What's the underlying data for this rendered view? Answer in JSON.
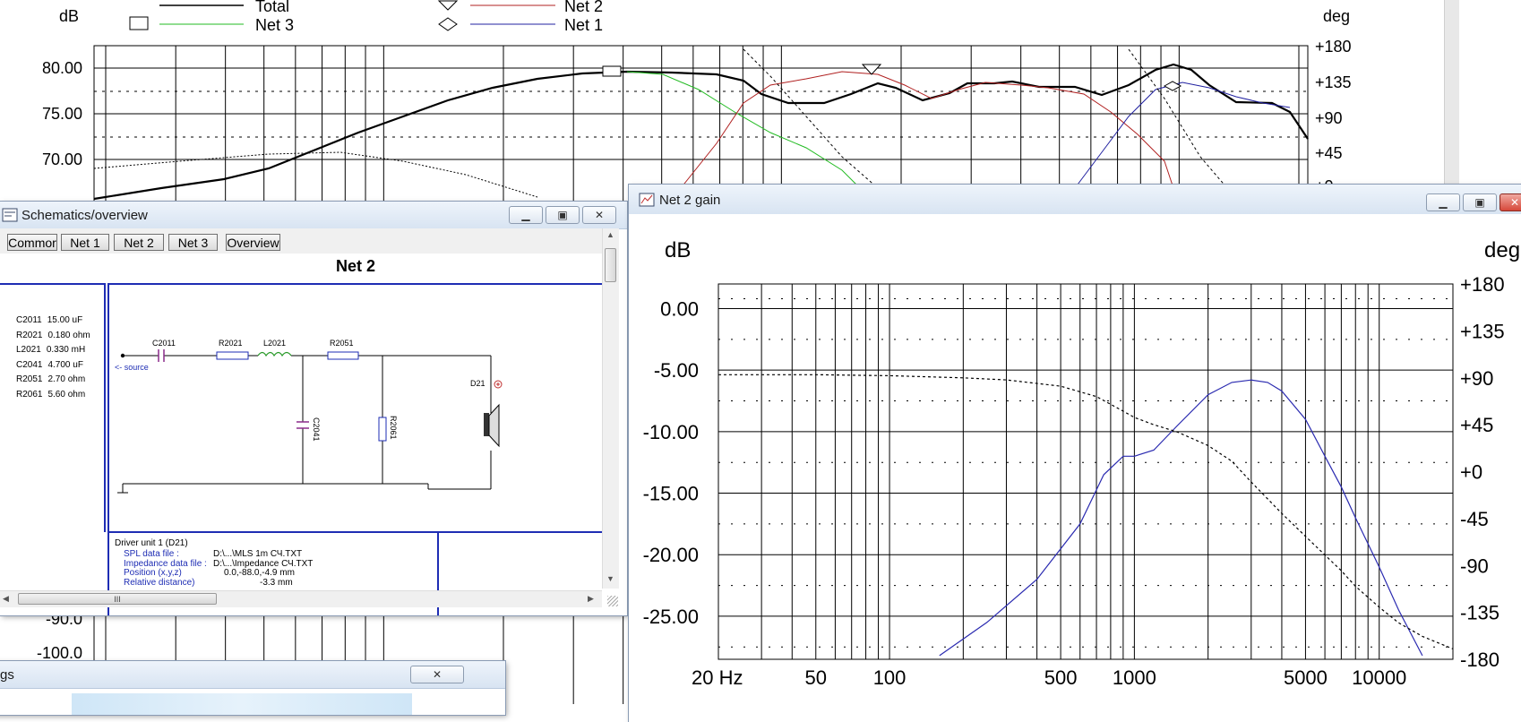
{
  "bg_chart": {
    "left_unit": "dB",
    "right_unit": "deg",
    "left_ticks": [
      "80.00",
      "75.00",
      "70.00"
    ],
    "lower_left_ticks": [
      "-90.0",
      "-100.0"
    ],
    "right_ticks": [
      "+180",
      "+135",
      "+90",
      "+45",
      "+0"
    ],
    "legend": [
      {
        "label": "Total",
        "color": "#000000",
        "marker": "square"
      },
      {
        "label": "Net 3",
        "color": "#22bb22",
        "marker": "square"
      },
      {
        "label": "Net 2",
        "color": "#b02020",
        "marker": "triangle"
      },
      {
        "label": "Net 1",
        "color": "#2020a0",
        "marker": "diamond"
      }
    ]
  },
  "schematics": {
    "title": "Schematics/overview",
    "tabs": [
      "Commor",
      "Net 1",
      "Net 2",
      "Net 3",
      "Overview"
    ],
    "heading": "Net 2",
    "components": [
      {
        "ref": "C2011",
        "value": "15.00 uF"
      },
      {
        "ref": "R2021",
        "value": "0.180 ohm"
      },
      {
        "ref": "L2021",
        "value": "0.330 mH"
      },
      {
        "ref": "C2041",
        "value": "4.700 uF"
      },
      {
        "ref": "R2051",
        "value": "2.70 ohm"
      },
      {
        "ref": "R2061",
        "value": "5.60 ohm"
      }
    ],
    "labels": {
      "source": "<- source",
      "driver": "D21",
      "c2011": "C2011",
      "r2021": "R2021",
      "l2021": "L2021",
      "r2051": "R2051",
      "c2041": "C2041",
      "r2061": "R2061"
    },
    "driver_info": {
      "heading": "Driver unit 1 (D21)",
      "rows": [
        {
          "label": "SPL data file :",
          "value": "D:\\...\\MLS 1m СЧ.TXT"
        },
        {
          "label": "Impedance data file :",
          "value": "D:\\...\\Impedance СЧ.TXT"
        },
        {
          "label": "Position (x,y,z)",
          "value": "0.0,-88.0,-4.9 mm"
        },
        {
          "label": "Relative distance)",
          "value": "-3.3 mm"
        }
      ]
    },
    "hscroll_glyph": "III"
  },
  "small_window": {
    "title_fragment": "gs"
  },
  "net2_gain": {
    "title": "Net 2 gain",
    "chart_data": {
      "type": "line",
      "title": "",
      "ylabel": "dB",
      "y2label": "deg",
      "x_scale": "log",
      "xlim": [
        20,
        20000
      ],
      "ylim": [
        -28.5,
        2
      ],
      "y2lim": [
        -180,
        180
      ],
      "x_tick_labels": [
        {
          "v": 20,
          "t": "20 Hz"
        },
        {
          "v": 50,
          "t": "50"
        },
        {
          "v": 100,
          "t": "100"
        },
        {
          "v": 500,
          "t": "500"
        },
        {
          "v": 1000,
          "t": "1000"
        },
        {
          "v": 5000,
          "t": "5000"
        },
        {
          "v": 10000,
          "t": "10000"
        }
      ],
      "y_tick_labels": [
        {
          "v": 0,
          "t": "0.00"
        },
        {
          "v": -5,
          "t": "-5.00"
        },
        {
          "v": -10,
          "t": "-10.00"
        },
        {
          "v": -15,
          "t": "-15.00"
        },
        {
          "v": -20,
          "t": "-20.00"
        },
        {
          "v": -25,
          "t": "-25.00"
        }
      ],
      "y2_tick_labels": [
        {
          "v": 180,
          "t": "+180"
        },
        {
          "v": 135,
          "t": "+135"
        },
        {
          "v": 90,
          "t": "+90"
        },
        {
          "v": 45,
          "t": "+45"
        },
        {
          "v": 0,
          "t": "+0"
        },
        {
          "v": -45,
          "t": "-45"
        },
        {
          "v": -90,
          "t": "-90"
        },
        {
          "v": -135,
          "t": "-135"
        },
        {
          "v": -180,
          "t": "-180"
        }
      ],
      "grid": true,
      "series": [
        {
          "axis": "left",
          "style": "solid",
          "color": "#2a2ab0",
          "x": [
            160,
            250,
            400,
            600,
            750,
            900,
            1000,
            1200,
            1500,
            2000,
            2500,
            3000,
            3500,
            4000,
            5000,
            6000,
            7000,
            8000,
            10000,
            12000,
            15000
          ],
          "y": [
            -28.2,
            -25.5,
            -22,
            -17.5,
            -13.5,
            -12,
            -12,
            -11.5,
            -9.5,
            -7,
            -6,
            -5.8,
            -6,
            -6.7,
            -9,
            -12,
            -14.5,
            -17,
            -21,
            -24.5,
            -28.2
          ]
        },
        {
          "axis": "right",
          "style": "dotted",
          "color": "#000000",
          "x": [
            20,
            50,
            100,
            200,
            300,
            500,
            700,
            900,
            1000,
            1200,
            1500,
            2000,
            2500,
            3000,
            4000,
            5000,
            6000,
            7000,
            8000,
            10000,
            12000,
            15000,
            20000
          ],
          "y": [
            93,
            93,
            92,
            90,
            88,
            82,
            72,
            58,
            52,
            45,
            38,
            25,
            10,
            -10,
            -40,
            -62,
            -80,
            -95,
            -110,
            -130,
            -145,
            -158,
            -170
          ]
        }
      ]
    }
  }
}
